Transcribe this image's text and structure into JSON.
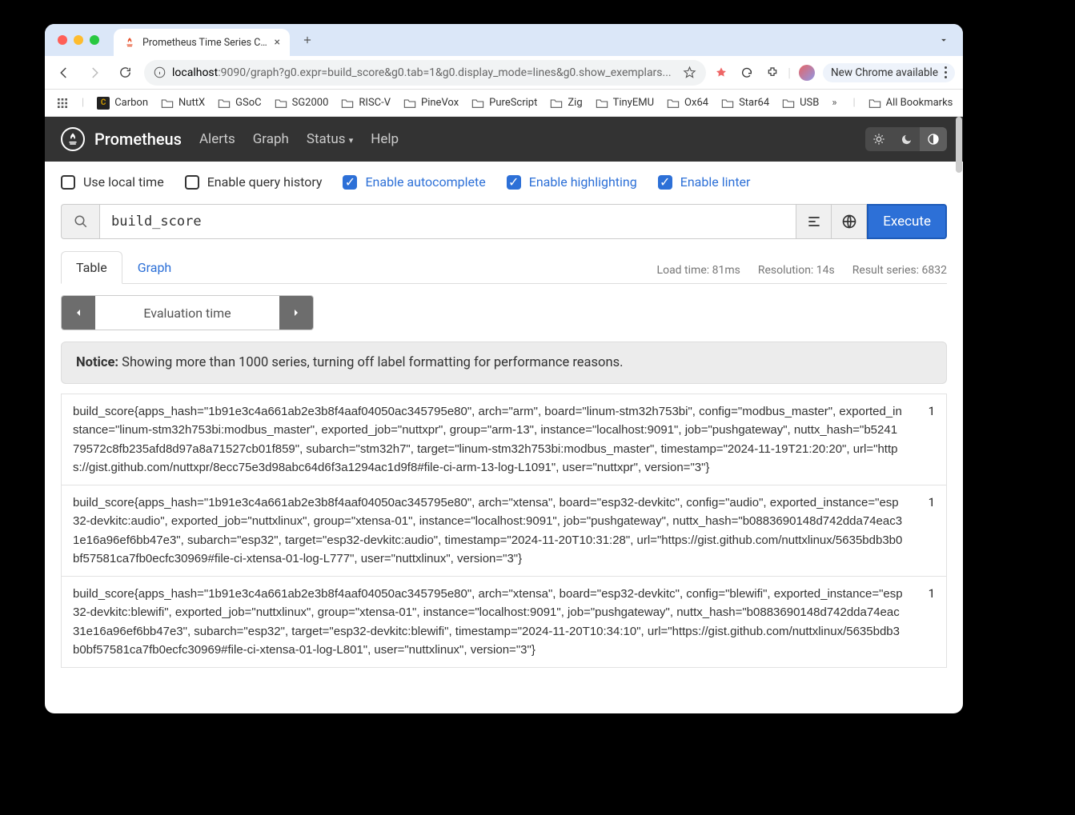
{
  "browser": {
    "tab_title": "Prometheus Time Series Colle",
    "url_host": "localhost",
    "url_port": ":9090",
    "url_path": "/graph?g0.expr=build_score&g0.tab=1&g0.display_mode=lines&g0.show_exemplars...",
    "chrome_chip": "New Chrome available",
    "bookmarks": [
      "Carbon",
      "NuttX",
      "GSoC",
      "SG2000",
      "RISC-V",
      "PineVox",
      "PureScript",
      "Zig",
      "TinyEMU",
      "Ox64",
      "Star64",
      "USB"
    ],
    "all_bookmarks": "All Bookmarks"
  },
  "nav": {
    "brand": "Prometheus",
    "links": [
      "Alerts",
      "Graph",
      "Status",
      "Help"
    ]
  },
  "options": {
    "use_local_time": "Use local time",
    "enable_query_history": "Enable query history",
    "enable_autocomplete": "Enable autocomplete",
    "enable_highlighting": "Enable highlighting",
    "enable_linter": "Enable linter"
  },
  "query": {
    "value": "build_score",
    "execute": "Execute"
  },
  "tabs": {
    "table": "Table",
    "graph": "Graph",
    "load_time": "Load time: 81ms",
    "resolution": "Resolution: 14s",
    "result_series": "Result series: 6832"
  },
  "eval": {
    "label": "Evaluation time"
  },
  "notice": {
    "prefix": "Notice:",
    "text": " Showing more than 1000 series, turning off label formatting for performance reasons."
  },
  "results": [
    {
      "metric": "build_score{apps_hash=\"1b91e3c4a661ab2e3b8f4aaf04050ac345795e80\", arch=\"arm\", board=\"linum-stm32h753bi\", config=\"modbus_master\", exported_instance=\"linum-stm32h753bi:modbus_master\", exported_job=\"nuttxpr\", group=\"arm-13\", instance=\"localhost:9091\", job=\"pushgateway\", nuttx_hash=\"b524179572c8fb235afd8d97a8a71527cb01f859\", subarch=\"stm32h7\", target=\"linum-stm32h753bi:modbus_master\", timestamp=\"2024-11-19T21:20:20\", url=\"https://gist.github.com/nuttxpr/8ecc75e3d98abc64d6f3a1294ac1d9f8#file-ci-arm-13-log-L1091\", user=\"nuttxpr\", version=\"3\"}",
      "value": "1"
    },
    {
      "metric": "build_score{apps_hash=\"1b91e3c4a661ab2e3b8f4aaf04050ac345795e80\", arch=\"xtensa\", board=\"esp32-devkitc\", config=\"audio\", exported_instance=\"esp32-devkitc:audio\", exported_job=\"nuttxlinux\", group=\"xtensa-01\", instance=\"localhost:9091\", job=\"pushgateway\", nuttx_hash=\"b0883690148d742dda74eac31e16a96ef6bb47e3\", subarch=\"esp32\", target=\"esp32-devkitc:audio\", timestamp=\"2024-11-20T10:31:28\", url=\"https://gist.github.com/nuttxlinux/5635bdb3b0bf57581ca7fb0ecfc30969#file-ci-xtensa-01-log-L777\", user=\"nuttxlinux\", version=\"3\"}",
      "value": "1"
    },
    {
      "metric": "build_score{apps_hash=\"1b91e3c4a661ab2e3b8f4aaf04050ac345795e80\", arch=\"xtensa\", board=\"esp32-devkitc\", config=\"blewifi\", exported_instance=\"esp32-devkitc:blewifi\", exported_job=\"nuttxlinux\", group=\"xtensa-01\", instance=\"localhost:9091\", job=\"pushgateway\", nuttx_hash=\"b0883690148d742dda74eac31e16a96ef6bb47e3\", subarch=\"esp32\", target=\"esp32-devkitc:blewifi\", timestamp=\"2024-11-20T10:34:10\", url=\"https://gist.github.com/nuttxlinux/5635bdb3b0bf57581ca7fb0ecfc30969#file-ci-xtensa-01-log-L801\", user=\"nuttxlinux\", version=\"3\"}",
      "value": "1"
    }
  ]
}
